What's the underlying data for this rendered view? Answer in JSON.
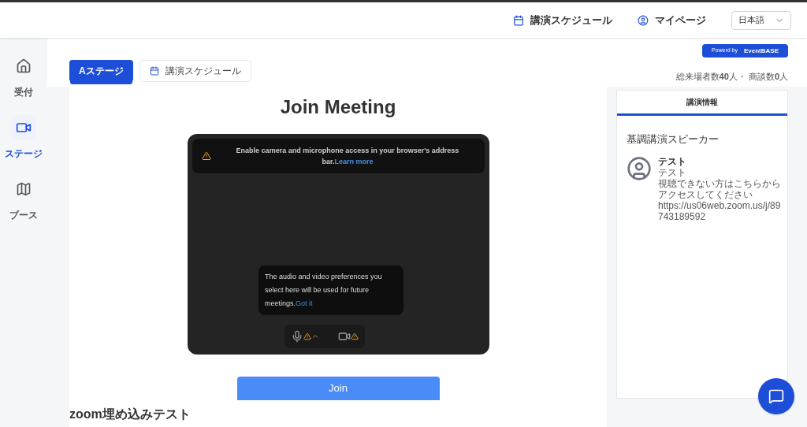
{
  "header": {
    "links": [
      {
        "kind": "calendar",
        "label": "講演スケジュール"
      },
      {
        "kind": "user",
        "label": "マイページ"
      }
    ],
    "language": {
      "value": "日本語"
    },
    "powered": {
      "prefix": "Powerd by",
      "brand": "EventBASE"
    }
  },
  "sidebar": {
    "items": [
      {
        "kind": "home",
        "label": "受付",
        "selected": false
      },
      {
        "kind": "stage",
        "label": "ステージ",
        "selected": true
      },
      {
        "kind": "map",
        "label": "ブース",
        "selected": false
      }
    ]
  },
  "tabs": [
    {
      "kind": "plain",
      "label": "Aステージ",
      "selected": true
    },
    {
      "kind": "calendar",
      "label": "講演スケジュール",
      "selected": false
    }
  ],
  "stats": "総来場者数**40**人・ 商談数**0**人",
  "meeting": {
    "title": "Join Meeting",
    "banner": "Enable camera and microphone access in your browser's address bar.",
    "banner_link": "Learn more",
    "tooltip": "The audio and video preferences you select here will be used for future meetings.",
    "tooltip_link": "Got it",
    "join": "Join"
  },
  "section_title": "zoom埋め込みテスト",
  "info": {
    "tab": "講演情報",
    "heading": "基調講演スピーカー",
    "speaker": {
      "name": "テスト",
      "role": "テスト",
      "note": "視聴できない方はこちらからアクセスしてください",
      "url": "https://us06web.zoom.us/j/89743189592"
    }
  }
}
